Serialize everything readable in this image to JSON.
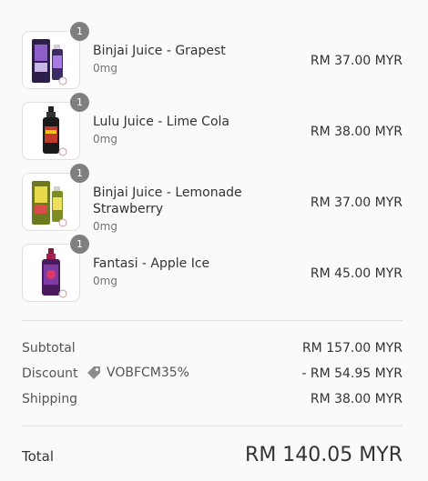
{
  "items": [
    {
      "name": "Binjai Juice - Grapest",
      "variant": "0mg",
      "price": "RM 37.00 MYR",
      "qty": "1",
      "image_icon": "vape-bottle-box-grape"
    },
    {
      "name": "Lulu Juice - Lime Cola",
      "variant": "0mg",
      "price": "RM 38.00 MYR",
      "qty": "1",
      "image_icon": "vape-bottle-black"
    },
    {
      "name": "Binjai Juice - Lemonade Strawberry",
      "variant": "0mg",
      "price": "RM 37.00 MYR",
      "qty": "1",
      "image_icon": "vape-bottle-box-yellow"
    },
    {
      "name": "Fantasi - Apple Ice",
      "variant": "0mg",
      "price": "RM 45.00 MYR",
      "qty": "1",
      "image_icon": "vape-bottle-purple"
    }
  ],
  "summary": {
    "subtotal_label": "Subtotal",
    "subtotal_value": "RM 157.00 MYR",
    "discount_label": "Discount",
    "discount_code": "VOBFCM35%",
    "discount_value": "- RM 54.95 MYR",
    "shipping_label": "Shipping",
    "shipping_value": "RM 38.00 MYR"
  },
  "total": {
    "label": "Total",
    "value": "RM 140.05 MYR"
  },
  "colors": {
    "background": "#fafafa",
    "badge": "#7f7f7f",
    "divider": "#e1e1e1"
  }
}
